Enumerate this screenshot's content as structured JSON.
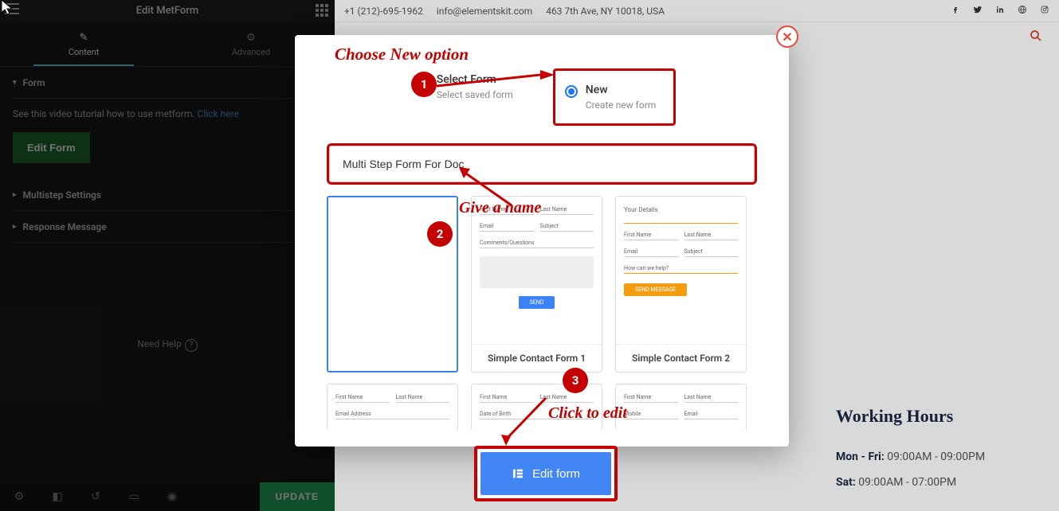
{
  "sidebar": {
    "title": "Edit MetForm",
    "tabs": [
      {
        "label": "Content",
        "icon": "✎",
        "active": true
      },
      {
        "label": "Advanced",
        "icon": "⚙",
        "active": false
      }
    ],
    "sections": {
      "form": "Form",
      "multistep": "Multistep Settings",
      "response": "Response Message"
    },
    "tutorial_text": "See this video tutorial how to use metform.",
    "tutorial_link": "Click here",
    "edit_form_btn": "Edit Form",
    "need_help": "Need Help",
    "update_btn": "UPDATE"
  },
  "page": {
    "phone": "+1 (212)-695-1962",
    "email": "info@elementskit.com",
    "address": "463 7th Ave, NY 10018, USA",
    "working_hours_title": "Working Hours",
    "hours": [
      {
        "label": "Mon - Fri:",
        "value": "09:00AM - 09:00PM"
      },
      {
        "label": "Sat:",
        "value": "09:00AM - 07:00PM"
      }
    ]
  },
  "modal": {
    "options": [
      {
        "title": "Select Form",
        "sub": "Select saved form",
        "checked": false
      },
      {
        "title": "New",
        "sub": "Create new form",
        "checked": true
      }
    ],
    "name_value": "Multi Step Form For Doc",
    "templates_row1": [
      {
        "name": "",
        "kind": "blank"
      },
      {
        "name": "Simple Contact Form 1",
        "kind": "contact1"
      },
      {
        "name": "Simple Contact Form 2",
        "kind": "contact2"
      }
    ],
    "templates_row2_fields": {
      "first_name": "First Name",
      "last_name": "Last Name",
      "email_address": "Email Address",
      "date_of_birth": "Date of Birth",
      "mobile": "Mobile",
      "email": "Email"
    },
    "edit_form_label": "Edit form",
    "preview_labels": {
      "first_name": "First Name",
      "last_name": "Last Name",
      "email": "Email",
      "subject": "Subject",
      "comments": "Comments/Questions",
      "send": "SEND",
      "your_details": "Your Details",
      "how_help": "How can we help?",
      "send_message": "SEND MESSAGE"
    }
  },
  "annotations": {
    "choose": "Choose New option",
    "give_name": "Give a name",
    "click_edit": "Click to edit",
    "num1": "1",
    "num2": "2",
    "num3": "3"
  },
  "icons": {
    "close": "✕",
    "question": "?",
    "gear": "⚙",
    "layers": "❐",
    "history": "↺",
    "responsive": "⛶",
    "eye": "👁"
  }
}
